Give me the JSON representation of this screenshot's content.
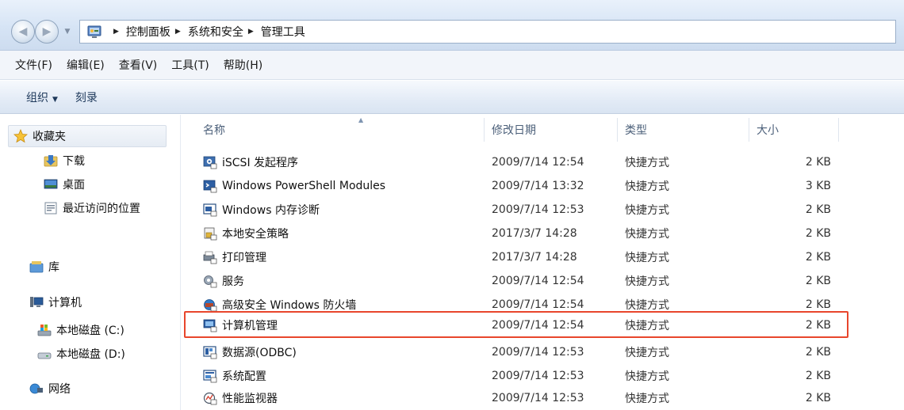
{
  "breadcrumb": {
    "items": [
      "控制面板",
      "系统和安全",
      "管理工具"
    ]
  },
  "menu": {
    "items": [
      "文件(F)",
      "编辑(E)",
      "查看(V)",
      "工具(T)",
      "帮助(H)"
    ]
  },
  "command_bar": {
    "organize": "组织",
    "burn": "刻录"
  },
  "nav": {
    "favorites": "收藏夹",
    "downloads": "下载",
    "desktop": "桌面",
    "recent": "最近访问的位置",
    "libraries": "库",
    "computer": "计算机",
    "disk_c": "本地磁盘 (C:)",
    "disk_d": "本地磁盘 (D:)",
    "network": "网络"
  },
  "columns": {
    "name": "名称",
    "date": "修改日期",
    "type": "类型",
    "size": "大小"
  },
  "files": [
    {
      "name": "iSCSI 发起程序",
      "date": "2009/7/14 12:54",
      "type": "快捷方式",
      "size": "2 KB",
      "icon": "iscsi-icon"
    },
    {
      "name": "Windows PowerShell Modules",
      "date": "2009/7/14 13:32",
      "type": "快捷方式",
      "size": "3 KB",
      "icon": "powershell-icon"
    },
    {
      "name": "Windows 内存诊断",
      "date": "2009/7/14 12:53",
      "type": "快捷方式",
      "size": "2 KB",
      "icon": "memory-diagnostic-icon"
    },
    {
      "name": "本地安全策略",
      "date": "2017/3/7 14:28",
      "type": "快捷方式",
      "size": "2 KB",
      "icon": "security-policy-icon"
    },
    {
      "name": "打印管理",
      "date": "2017/3/7 14:28",
      "type": "快捷方式",
      "size": "2 KB",
      "icon": "print-management-icon"
    },
    {
      "name": "服务",
      "date": "2009/7/14 12:54",
      "type": "快捷方式",
      "size": "2 KB",
      "icon": "services-icon"
    },
    {
      "name": "高级安全 Windows 防火墙",
      "date": "2009/7/14 12:54",
      "type": "快捷方式",
      "size": "2 KB",
      "icon": "firewall-icon"
    },
    {
      "name": "计算机管理",
      "date": "2009/7/14 12:54",
      "type": "快捷方式",
      "size": "2 KB",
      "icon": "computer-management-icon"
    },
    {
      "name": "数据源(ODBC)",
      "date": "2009/7/14 12:53",
      "type": "快捷方式",
      "size": "2 KB",
      "icon": "odbc-icon"
    },
    {
      "name": "系统配置",
      "date": "2009/7/14 12:53",
      "type": "快捷方式",
      "size": "2 KB",
      "icon": "system-config-icon"
    },
    {
      "name": "性能监视器",
      "date": "2009/7/14 12:53",
      "type": "快捷方式",
      "size": "2 KB",
      "icon": "performance-monitor-icon"
    }
  ],
  "colors": {
    "highlight": "#e8462c",
    "accent": "#1e395b"
  }
}
